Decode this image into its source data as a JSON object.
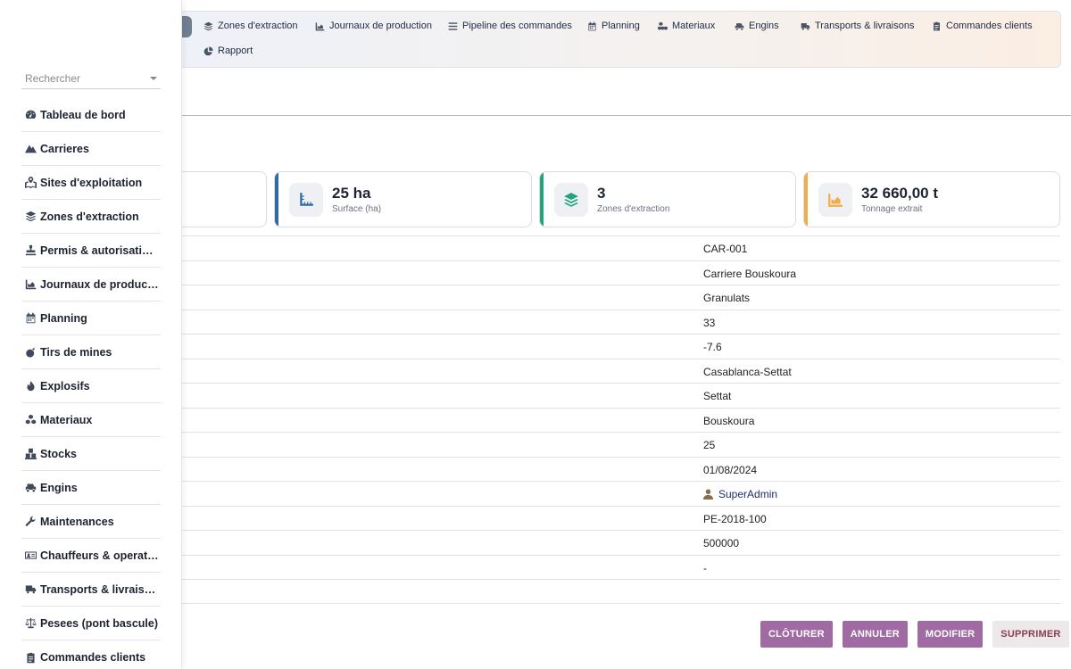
{
  "topnav": {
    "items": [
      {
        "label": "Zones d'extraction",
        "icon": "layers-icon"
      },
      {
        "label": "Journaux de production",
        "icon": "chart-icon"
      },
      {
        "label": "Pipeline des commandes",
        "icon": "list-icon"
      },
      {
        "label": "Planning",
        "icon": "calendar-icon"
      },
      {
        "label": "Materiaux",
        "icon": "cubes-icon"
      },
      {
        "label": "Engins",
        "icon": "vehicle-icon"
      },
      {
        "label": "Transports & livraisons",
        "icon": "truck-icon"
      },
      {
        "label": "Commandes clients",
        "icon": "clipboard-icon"
      },
      {
        "label": "Rapport",
        "icon": "pie-icon"
      }
    ]
  },
  "stats": [
    {
      "value": "25 ha",
      "label": "Surface (ha)",
      "icon": "ruler-icon",
      "accent": "#2e6aa8"
    },
    {
      "value": "3",
      "label": "Zones d'extraction",
      "icon": "layers-icon",
      "accent": "#1fa57a"
    },
    {
      "value": "32 660,00 t",
      "label": "Tonnage extrait",
      "icon": "chart-icon",
      "accent": "#f0ad4e"
    }
  ],
  "details": {
    "values": [
      "CAR-001",
      "Carriere Bouskoura",
      "Granulats",
      "33",
      "-7.6",
      "Casablanca-Settat",
      "Settat",
      "Bouskoura",
      "25",
      "01/08/2024",
      "SuperAdmin",
      "PE-2018-100",
      "500000",
      "-",
      ""
    ]
  },
  "actions": {
    "close": "CLÔTURER",
    "cancel": "ANNULER",
    "edit": "MODIFIER",
    "delete": "SUPPRIMER"
  },
  "sidebar": {
    "search_placeholder": "Rechercher",
    "items": [
      {
        "label": "Tableau de bord",
        "icon": "dashboard-icon"
      },
      {
        "label": "Carrieres",
        "icon": "mountain-icon"
      },
      {
        "label": "Sites d'exploitation",
        "icon": "map-icon"
      },
      {
        "label": "Zones d'extraction",
        "icon": "layers-icon"
      },
      {
        "label": "Permis & autorisations",
        "icon": "stamp-icon"
      },
      {
        "label": "Journaux de production",
        "icon": "chart-icon"
      },
      {
        "label": "Planning",
        "icon": "calendar-icon"
      },
      {
        "label": "Tirs de mines",
        "icon": "bomb-icon"
      },
      {
        "label": "Explosifs",
        "icon": "fire-icon"
      },
      {
        "label": "Materiaux",
        "icon": "cubes-icon"
      },
      {
        "label": "Stocks",
        "icon": "boxes-icon"
      },
      {
        "label": "Engins",
        "icon": "vehicle-icon"
      },
      {
        "label": "Maintenances",
        "icon": "wrench-icon"
      },
      {
        "label": "Chauffeurs & operateurs",
        "icon": "id-card-icon"
      },
      {
        "label": "Transports & livraisons",
        "icon": "truck-icon"
      },
      {
        "label": "Pesees (pont bascule)",
        "icon": "scale-icon"
      },
      {
        "label": "Commandes clients",
        "icon": "clipboard-icon"
      }
    ]
  }
}
